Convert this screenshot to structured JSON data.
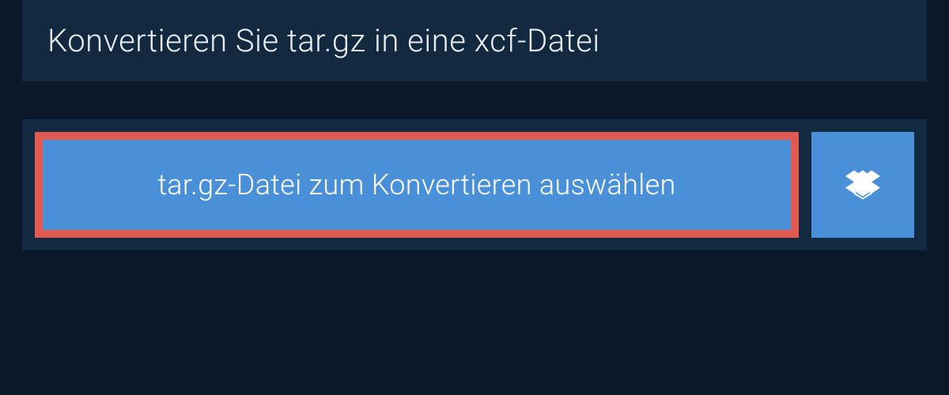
{
  "header": {
    "title": "Konvertieren Sie tar.gz in eine xcf-Datei"
  },
  "upload": {
    "select_label": "tar.gz-Datei zum Konvertieren auswählen",
    "dropbox_icon": "dropbox"
  },
  "colors": {
    "background": "#0a1829",
    "panel": "#13293f",
    "button": "#4a90d9",
    "highlight_border": "#e05a52",
    "text_light": "#e8eef4",
    "text_white": "#ffffff"
  }
}
